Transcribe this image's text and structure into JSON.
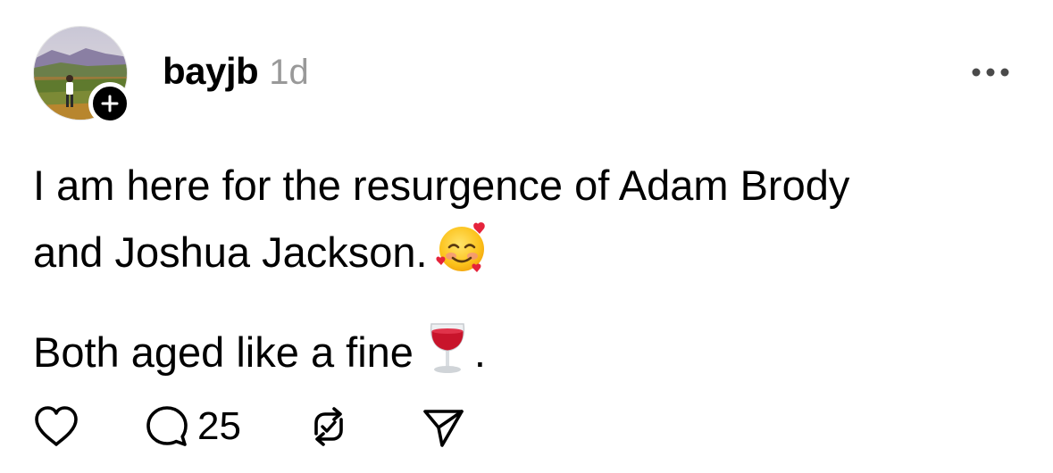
{
  "post": {
    "username": "bayjb",
    "timestamp": "1d",
    "body": {
      "line1": "I am here for the resurgence of Adam Brody",
      "line2": "and Joshua Jackson.",
      "line3_before_emoji": "Both aged like a fine",
      "line3_after_emoji": "."
    },
    "emojis": [
      "smiling-face-with-hearts-icon",
      "wine-glass-icon"
    ],
    "stats": {
      "reply_count": "25"
    }
  },
  "icons": {
    "avatar_badge": "plus-icon",
    "menu": "more-icon",
    "actions": [
      "heart-icon",
      "comment-icon",
      "repost-icon",
      "share-icon"
    ]
  },
  "colors": {
    "text": "#000000",
    "muted": "#999999",
    "icon": "#000000",
    "background": "#ffffff"
  }
}
